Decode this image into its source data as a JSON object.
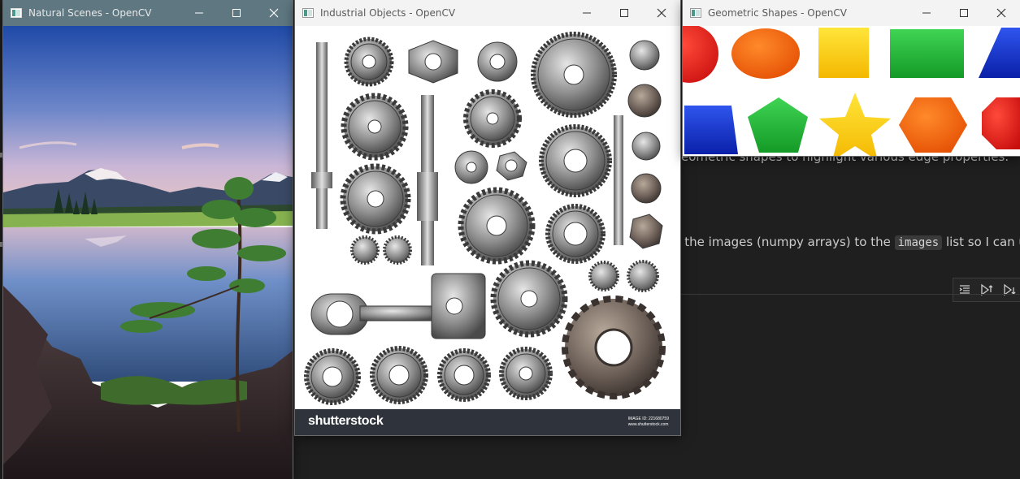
{
  "editor": {
    "line1": "eometric shapes to highlight various edge properties.",
    "line2_prefix": "g the images (numpy arrays) to the ",
    "line2_code": "images",
    "line2_suffix": " list so I can u"
  },
  "windows": {
    "natural": {
      "title": "Natural Scenes - OpenCV"
    },
    "industrial": {
      "title": "Industrial Objects - OpenCV",
      "brand": "shutterstock",
      "image_id_label": "IMAGE ID: 221680759",
      "site": "www.shutterstock.com"
    },
    "geometric": {
      "title": "Geometric Shapes - OpenCV"
    }
  },
  "colors": {
    "red": "#e31b1b",
    "orange": "#ff6a00",
    "yellow": "#ffd400",
    "green": "#22b537",
    "blue": "#1537d6"
  }
}
